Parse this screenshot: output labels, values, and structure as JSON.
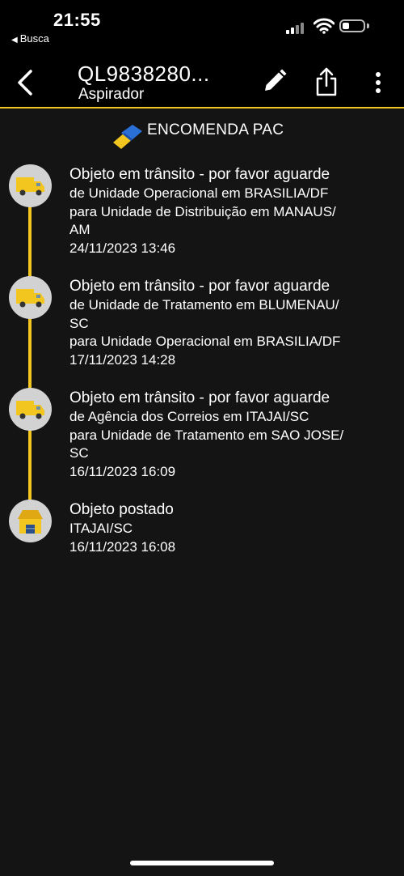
{
  "status_bar": {
    "time": "21:55",
    "back_app_label": "Busca",
    "signal_icon": "cellular-signal-icon",
    "wifi_icon": "wifi-icon",
    "battery_icon": "battery-icon",
    "battery_level": 0.35
  },
  "nav": {
    "back_icon": "chevron-left-icon",
    "title": "QL9838280...",
    "subtitle": "Aspirador",
    "edit_icon": "pencil-icon",
    "share_icon": "share-icon",
    "more_icon": "more-vertical-icon"
  },
  "service": {
    "logo": "correios-logo",
    "label": "ENCOMENDA PAC"
  },
  "colors": {
    "accent": "#f2c61f",
    "background": "#141414",
    "icon_circle": "#d2d2d2"
  },
  "events": [
    {
      "icon": "truck-icon",
      "status": "Objeto em trânsito - por favor aguarde",
      "line1": "de Unidade Operacional em BRASILIA/DF",
      "line2": "para Unidade de Distribuição em MANAUS/",
      "line3": "AM",
      "datetime": "24/11/2023 13:46"
    },
    {
      "icon": "truck-icon",
      "status": "Objeto em trânsito - por favor aguarde",
      "line1": "de Unidade de Tratamento em BLUMENAU/",
      "line2": "SC",
      "line3": "para Unidade Operacional em BRASILIA/DF",
      "datetime": "17/11/2023 14:28"
    },
    {
      "icon": "truck-icon",
      "status": "Objeto em trânsito - por favor aguarde",
      "line1": "de Agência dos Correios em ITAJAI/SC",
      "line2": "para Unidade de Tratamento em SAO JOSE/",
      "line3": "SC",
      "datetime": "16/11/2023 16:09"
    },
    {
      "icon": "post-office-icon",
      "status": "Objeto postado",
      "line1": "ITAJAI/SC",
      "datetime": "16/11/2023 16:08"
    }
  ]
}
